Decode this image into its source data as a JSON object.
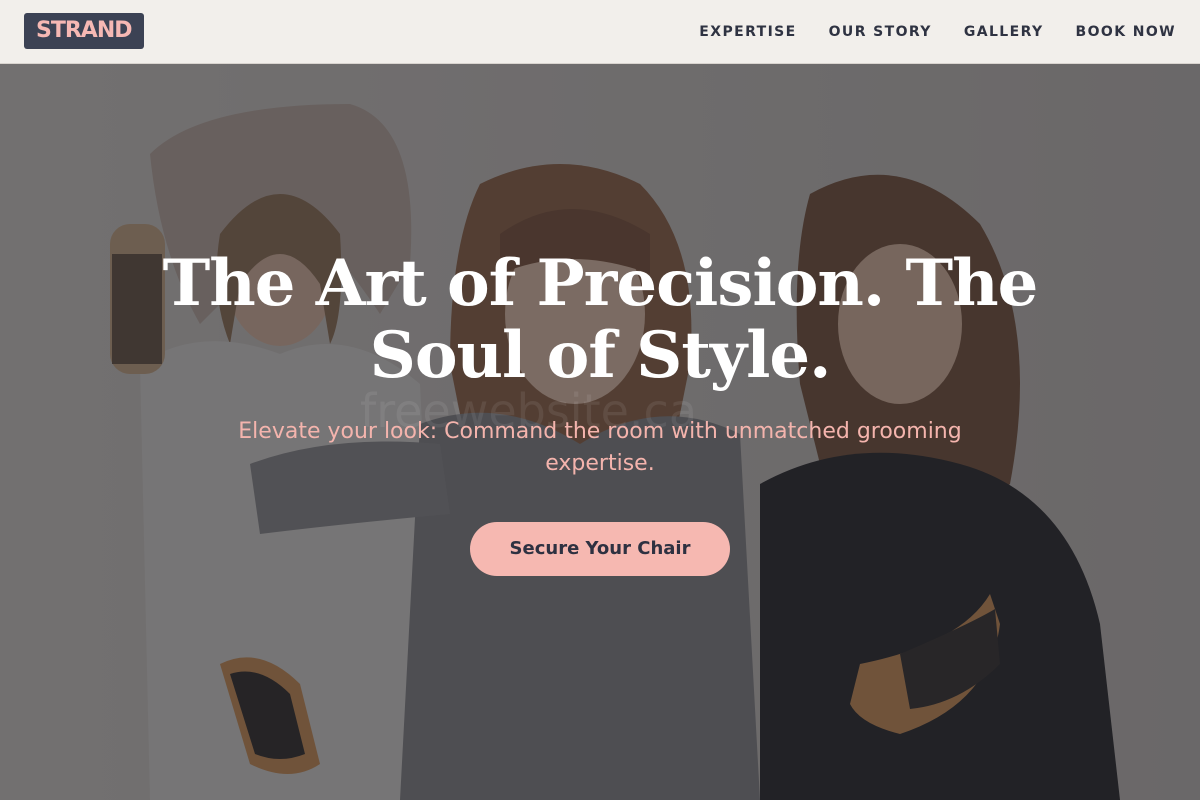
{
  "brand": {
    "logo_text": "STRAND",
    "logo_bg": "#3c4254",
    "logo_color": "#f6b8b4"
  },
  "nav": {
    "items": [
      {
        "label": "EXPERTISE"
      },
      {
        "label": "OUR STORY"
      },
      {
        "label": "GALLERY"
      },
      {
        "label": "BOOK NOW"
      }
    ]
  },
  "hero": {
    "title": "The Art of Precision. The Soul of Style.",
    "subtitle": "Elevate your look: Command the room with unmatched grooming expertise.",
    "cta_label": "Secure Your Chair",
    "watermark": "freewebsite.ca",
    "image_description_icon": "stylists-photo",
    "colors": {
      "subtitle": "#f4b4ad",
      "cta_bg": "#f6b8b1",
      "title": "#ffffff"
    }
  }
}
